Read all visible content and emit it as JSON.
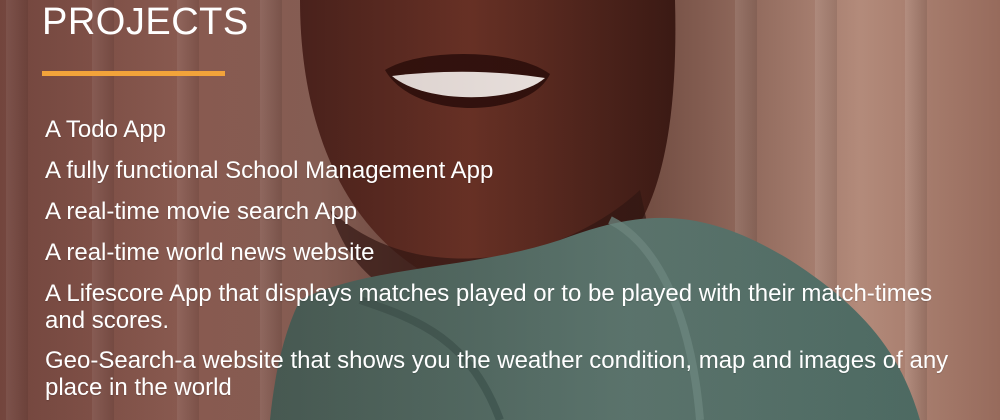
{
  "section": {
    "title": "PROJECTS"
  },
  "projects": [
    "A Todo App",
    "A fully functional School Management App",
    "A real-time movie search App",
    "A real-time world news website",
    "A Lifescore App that displays matches played or to be played with their match-times and scores.",
    "Geo-Search-a website that shows you the weather condition, map and images of any place in the world"
  ],
  "colors": {
    "accent": "#f2a33a",
    "text": "#ffffff"
  }
}
